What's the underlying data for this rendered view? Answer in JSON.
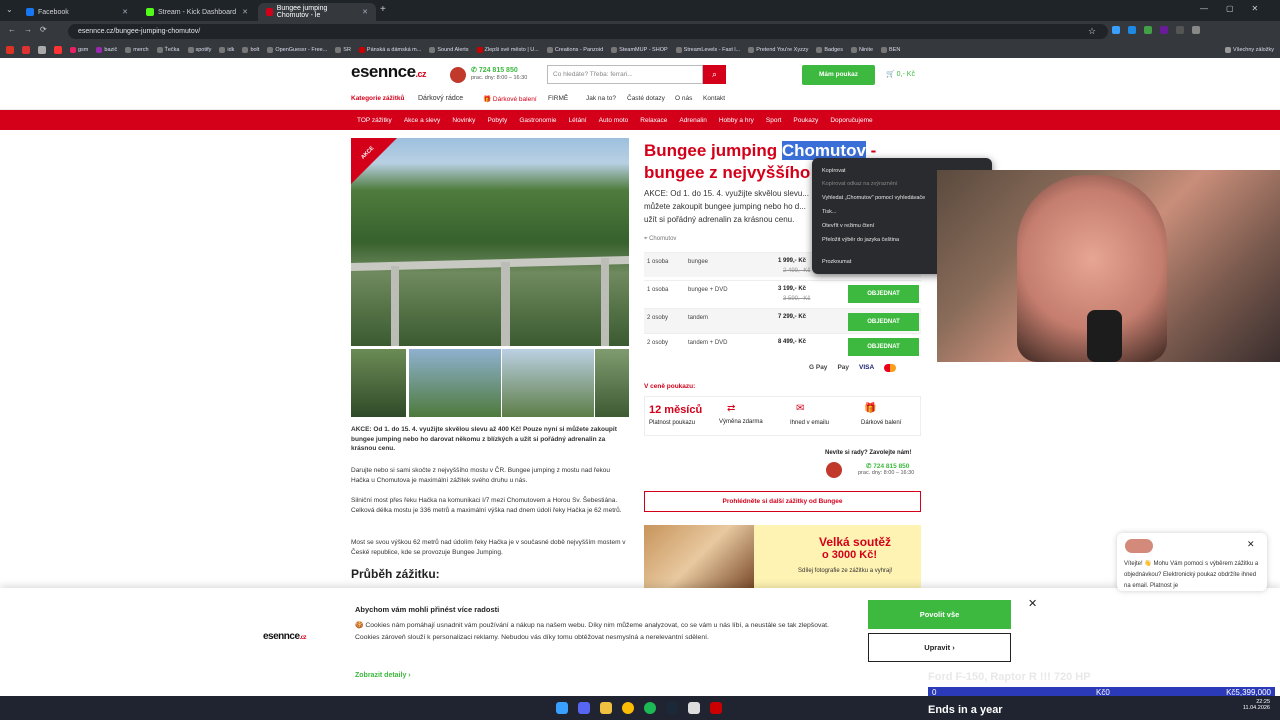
{
  "browser": {
    "tabs": [
      {
        "title": "Facebook",
        "color": "#1877f2"
      },
      {
        "title": "Stream - Kick Dashboard",
        "color": "#53fc18"
      },
      {
        "title": "Bungee jumping Chomutov - le",
        "color": "#d4001a"
      }
    ],
    "url": "esennce.cz/bungee-jumping-chomutov/",
    "bookmarks": [
      "gsm",
      "bazič",
      "merch",
      "Ťečka",
      "spotify",
      "idk",
      "bolt",
      "OpenGuessr - Free...",
      "SR",
      "Pánská a dámská m...",
      "Sound Alerts",
      "Zlepši své město | U...",
      "Creations - Panzoid",
      "SteamMUP - SHOP",
      "StreamLevels - Fast l...",
      "Pretend You're Xyzzy",
      "Badges",
      "Ninite",
      "BEN",
      "Všechny záložky"
    ]
  },
  "site": {
    "logo_text": "esennce",
    "logo_tld": ".cz",
    "phone": "724 815 850",
    "hours": "prac. dny: 8:00 – 16:30",
    "search_placeholder": "Co hledáte? Třeba: ferrari...",
    "voucher_button": "Mám poukaz",
    "cart": "0,- Kč",
    "subnav": [
      "Kategorie zážitků",
      "Dárkový rádce",
      "Dárkové balení",
      "FIRMĚ",
      "Jak na to?",
      "Časté dotazy",
      "O nás",
      "Kontakt"
    ],
    "categories": [
      "TOP zážitky",
      "Akce a slevy",
      "Novinky",
      "Pobyty",
      "Gastronomie",
      "Létání",
      "Auto moto",
      "Relaxace",
      "Adrenalin",
      "Hobby a hry",
      "Sport",
      "Poukazy",
      "Doporučujeme"
    ],
    "badge": "AKCE"
  },
  "product": {
    "title_part1": "Bungee jumping ",
    "title_highlight": "Chomutov",
    "title_part2": " -",
    "title_line2": "bungee z nejvyššího m",
    "intro": "AKCE: Od 1. do 15. 4. využijte skvělou slevu... můžete zakoupit bungee jumping nebo ho d... užít si pořádný adrenalin za krásnou cenu.",
    "location": "Chomutov",
    "rows": [
      {
        "persons": "1 osoba",
        "type": "bungee",
        "price": "1 999,- Kč",
        "old": "2 499,- Kč",
        "button": ""
      },
      {
        "persons": "1 osoba",
        "type": "bungee + DVD",
        "price": "3 199,- Kč",
        "old": "3 599,- Kč",
        "button": "OBJEDNAT"
      },
      {
        "persons": "2 osoby",
        "type": "tandem",
        "price": "7 299,- Kč",
        "old": "",
        "button": "OBJEDNAT"
      },
      {
        "persons": "2 osoby",
        "type": "tandem + DVD",
        "price": "8 499,- Kč",
        "old": "",
        "button": "OBJEDNAT"
      }
    ],
    "payments": [
      "G Pay",
      "Pay",
      "VISA"
    ],
    "in_price_label": "V ceně poukazu:",
    "features": [
      "12 měsíců",
      "Platnost poukazu",
      "Výměna zdarma",
      "Ihned v emailu",
      "Dárkové balení"
    ],
    "help_label": "Nevíte si rady? Zavolejte nám!",
    "more_button": "Prohlédněte si další zážitky od Bungee",
    "promo_title": "Velká soutěž",
    "promo_amount": "o 3000 Kč!",
    "promo_sub": "Sdílej fotografie ze zážitku a vyhraj!",
    "desc_bold": "AKCE: Od 1. do 15. 4. využijte skvělou slevu až 400 Kč! Pouze nyní si můžete zakoupit bungee jumping nebo ho darovat někomu z blízkých a užít si pořádný adrenalin za krásnou cenu.",
    "desc2": "Darujte nebo si sami skočte z nejvyššího mostu v ČR. Bungee jumping z mostu nad řekou Hačka u Chomutova je maximální zážitek svého druhu u nás.",
    "desc3": "Silniční most přes řeku Hačka na komunikaci I/7 mezi Chomutovem a Horou Sv. Šebestiána. Celková délka mostu je 336 metrů a maximální výška nad dnem údolí řeky Hačka je 62 metrů.",
    "desc4": "Most se svou výškou 62 metrů nad údolím řeky Hačka je v současné době nejvyšším mostem v České republice, kde se provozuje Bungee Jumping.",
    "section_heading": "Průběh zážitku:"
  },
  "context_menu": [
    "Kopírovat",
    "Kopírovat odkaz na zvýraznění",
    "Vyhledat „Chomutov\" pomocí vyhledávače",
    "Tisk...",
    "Otevřít v režimu čtení",
    "Přeložit výběr do jazyka čeština",
    "Prozkoumat"
  ],
  "cookie": {
    "title": "Abychom vám mohli přinést více radosti",
    "text": "Cookies nám pomáhají usnadnit vám používání a nákup na našem webu. Díky nim můžeme analyzovat, co se vám u nás líbí, a neustále se tak zlepšovat. Cookies zároveň slouží k personalizaci reklamy. Nebudou vás díky tomu obtěžovat nesmyslná a nerelevantní sdělení.",
    "details": "Zobrazit detaily",
    "allow": "Povolit vše",
    "edit": "Upravit"
  },
  "chat": {
    "text": "Vítejte! 👋 Mohu Vám pomoci s výběrem zážitku a objednávkou? Elektronický poukaz obdržíte ihned na email. Platnost je"
  },
  "overlay": {
    "car": "Ford F-150, Raptor R !!! 720 HP",
    "left": "0",
    "mid": "Kč0",
    "right": "Kč5,399,000",
    "ends": "Ends in a year"
  },
  "taskbar": {
    "time": "22:25",
    "date": "11.04.2026"
  }
}
